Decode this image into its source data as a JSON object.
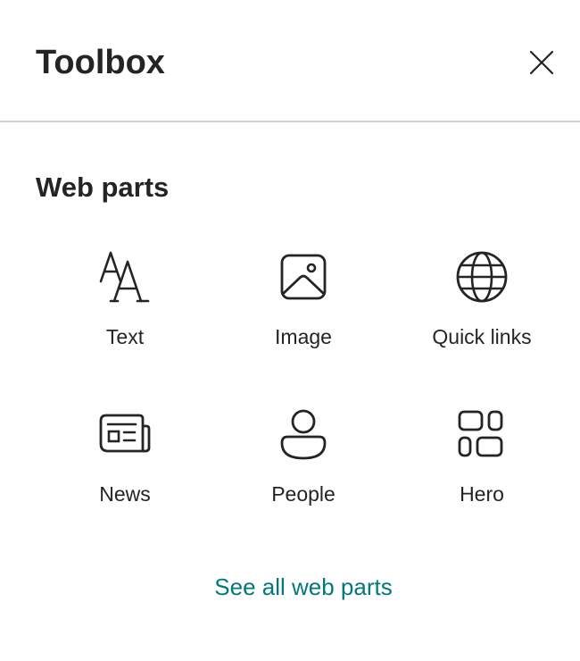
{
  "header": {
    "title": "Toolbox",
    "close_icon": "close-icon"
  },
  "section": {
    "title": "Web parts"
  },
  "web_parts": [
    {
      "label": "Text",
      "icon": "text-icon"
    },
    {
      "label": "Image",
      "icon": "image-icon"
    },
    {
      "label": "Quick links",
      "icon": "globe-icon"
    },
    {
      "label": "News",
      "icon": "news-icon"
    },
    {
      "label": "People",
      "icon": "person-icon"
    },
    {
      "label": "Hero",
      "icon": "hero-layout-icon"
    }
  ],
  "see_all": {
    "label": "See all web parts"
  },
  "colors": {
    "text": "#242424",
    "divider": "#d1d1d1",
    "link": "#03787c",
    "background": "#ffffff"
  }
}
